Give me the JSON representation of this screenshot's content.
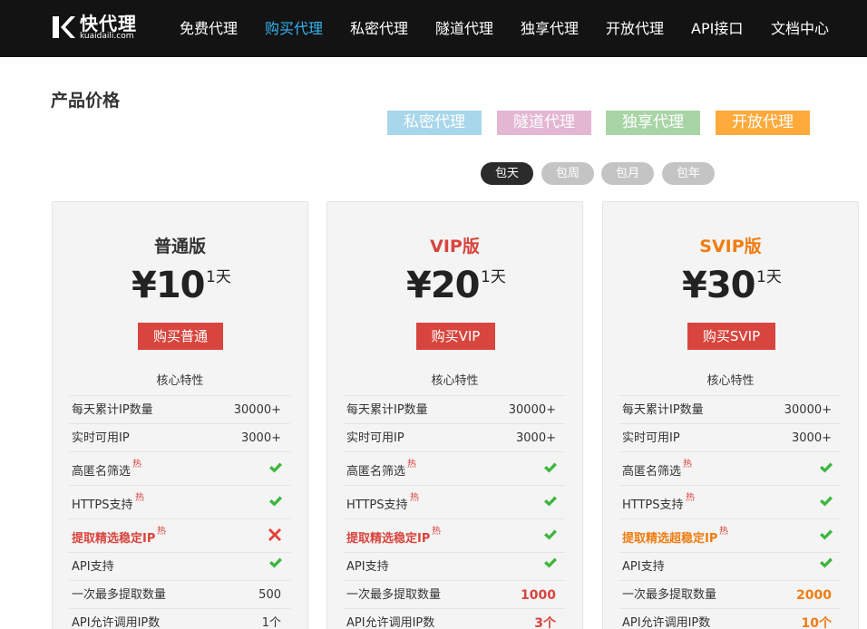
{
  "brand": {
    "name": "快代理",
    "domain": "kuaidaili.com"
  },
  "nav": {
    "items": [
      {
        "label": "免费代理",
        "active": false
      },
      {
        "label": "购买代理",
        "active": true
      },
      {
        "label": "私密代理",
        "active": false
      },
      {
        "label": "隧道代理",
        "active": false
      },
      {
        "label": "独享代理",
        "active": false
      },
      {
        "label": "开放代理",
        "active": false
      },
      {
        "label": "API接口",
        "active": false
      },
      {
        "label": "文档中心",
        "active": false
      }
    ],
    "active_color": "#36b4f4"
  },
  "page": {
    "title": "产品价格"
  },
  "product_tabs": [
    {
      "label": "私密代理",
      "color": "#a8d6ea"
    },
    {
      "label": "隧道代理",
      "color": "#e3b6d2"
    },
    {
      "label": "独享代理",
      "color": "#a9d5a6"
    },
    {
      "label": "开放代理",
      "color": "#ffaa3b"
    }
  ],
  "periods": [
    {
      "label": "包天",
      "active": true
    },
    {
      "label": "包周",
      "active": false
    },
    {
      "label": "包月",
      "active": false
    },
    {
      "label": "包年",
      "active": false
    }
  ],
  "plans": [
    {
      "name": "普通版",
      "name_color": "#333333",
      "price": "¥10",
      "unit": "1天",
      "buy_label": "购买普通",
      "core_title": "核心特性",
      "features": [
        {
          "label": "每天累计IP数量",
          "value": "30000+"
        },
        {
          "label": "实时可用IP",
          "value": "3000+"
        },
        {
          "label": "高匿名筛选",
          "hot": "热",
          "icon": "check-icon"
        },
        {
          "label": "HTTPS支持",
          "hot": "热",
          "icon": "check-icon"
        },
        {
          "label": "提取精选稳定IP",
          "hot": "热",
          "icon": "cross-icon",
          "highlight": true
        },
        {
          "label": "API支持",
          "icon": "check-icon"
        },
        {
          "label": "一次最多提取数量",
          "value": "500"
        },
        {
          "label": "API允许调用IP数",
          "value": "1个"
        }
      ]
    },
    {
      "name": "VIP版",
      "name_color": "#d8453e",
      "price": "¥20",
      "unit": "1天",
      "buy_label": "购买VIP",
      "core_title": "核心特性",
      "features": [
        {
          "label": "每天累计IP数量",
          "value": "30000+"
        },
        {
          "label": "实时可用IP",
          "value": "3000+"
        },
        {
          "label": "高匿名筛选",
          "hot": "热",
          "icon": "check-icon"
        },
        {
          "label": "HTTPS支持",
          "hot": "热",
          "icon": "check-icon"
        },
        {
          "label": "提取精选稳定IP",
          "hot": "热",
          "icon": "check-icon",
          "highlight": true
        },
        {
          "label": "API支持",
          "icon": "check-icon"
        },
        {
          "label": "一次最多提取数量",
          "value": "1000",
          "value_style": "red"
        },
        {
          "label": "API允许调用IP数",
          "value": "3个",
          "value_style": "red"
        }
      ]
    },
    {
      "name": "SVIP版",
      "name_color": "#f07d12",
      "price": "¥30",
      "unit": "1天",
      "buy_label": "购买SVIP",
      "core_title": "核心特性",
      "features": [
        {
          "label": "每天累计IP数量",
          "value": "30000+"
        },
        {
          "label": "实时可用IP",
          "value": "3000+"
        },
        {
          "label": "高匿名筛选",
          "hot": "热",
          "icon": "check-icon"
        },
        {
          "label": "HTTPS支持",
          "hot": "热",
          "icon": "check-icon"
        },
        {
          "label": "提取精选超稳定IP",
          "hot": "热",
          "icon": "check-icon",
          "highlight": true,
          "highlight_color": "orange"
        },
        {
          "label": "API支持",
          "icon": "check-icon"
        },
        {
          "label": "一次最多提取数量",
          "value": "2000",
          "value_style": "orange"
        },
        {
          "label": "API允许调用IP数",
          "value": "10个",
          "value_style": "orange"
        }
      ]
    }
  ]
}
